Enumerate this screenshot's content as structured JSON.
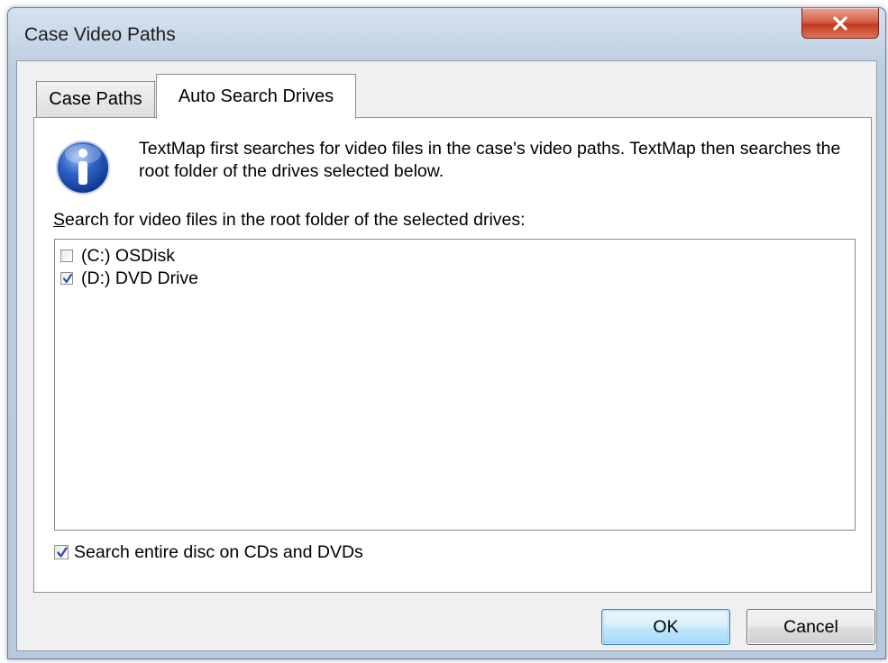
{
  "window": {
    "title": "Case Video Paths",
    "close_glyph": "✕"
  },
  "tabs": [
    {
      "label": "Case Paths",
      "selected": false
    },
    {
      "label": "Auto Search Drives",
      "selected": true
    }
  ],
  "info": {
    "icon": "info-icon",
    "text": "TextMap first searches for video files in the case's video paths.  TextMap then searches the root folder of the drives selected below."
  },
  "drives": {
    "label_accesskey": "S",
    "label_rest": "earch for video files in the root folder of the selected drives:",
    "items": [
      {
        "label": "(C:) OSDisk",
        "checked": false
      },
      {
        "label": "(D:) DVD Drive",
        "checked": true
      }
    ]
  },
  "search_entire_disc": {
    "label": "Search entire disc on CDs and DVDs",
    "checked": true
  },
  "buttons": {
    "ok_label": "OK",
    "cancel_label": "Cancel"
  }
}
